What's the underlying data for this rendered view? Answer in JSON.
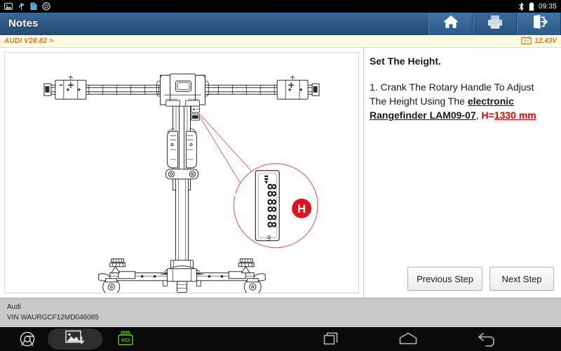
{
  "status_bar": {
    "clock": "09:35",
    "left_icons": [
      "screenshot-icon",
      "usb-icon",
      "sd-card-icon",
      "settings-icon"
    ],
    "right_icons": [
      "bluetooth-icon",
      "battery-icon"
    ]
  },
  "title_bar": {
    "title": "Notes",
    "buttons": [
      {
        "name": "home-button",
        "icon": "home-icon"
      },
      {
        "name": "print-button",
        "icon": "printer-icon"
      },
      {
        "name": "exit-button",
        "icon": "exit-icon"
      }
    ]
  },
  "breadcrumb": {
    "path": "AUDI V28.82 >",
    "voltage": "12.43V",
    "battery_icon": "battery-voltage-icon"
  },
  "diagram": {
    "alt": "headlight-aimer-stand-illustration",
    "callout_badge": "H",
    "display_label": "rangefinder-lcd-display"
  },
  "instructions": {
    "heading": "Set The Height.",
    "step_number": "1.",
    "text_part1": "Crank The Rotary Handle To Adjust The Height Using The ",
    "emphasis": "electronic Rangefinder LAM09-07",
    "text_part2": ", ",
    "measure_prefix": "H=",
    "measure_value": "1330 mm"
  },
  "step_buttons": {
    "previous": "Previous Step",
    "next": "Next Step"
  },
  "vehicle_info": {
    "make": "Audi",
    "vin": "VIN WAURGCF12MD046085"
  },
  "nav_bar": {
    "chrome_icon": "chrome-icon",
    "screenshot_icon": "screenshot-capture-icon",
    "vci_label": "VCI",
    "recents_icon": "recents-icon",
    "home_icon": "home-icon",
    "back_icon": "back-icon"
  },
  "colors": {
    "header_blue": "#2b5580",
    "accent_orange": "#e8702a",
    "alert_red": "#ee0000",
    "vci_green": "#5ec21a",
    "footer_gray": "#c8c8c8"
  }
}
